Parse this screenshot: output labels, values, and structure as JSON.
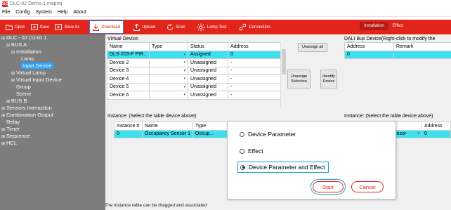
{
  "window": {
    "title": "DLC-02   Demo-1.maproj",
    "logo_text": "DLC"
  },
  "menu": [
    "File",
    "Config",
    "System",
    "Help",
    "About"
  ],
  "toolbar": {
    "open": "Open",
    "save": "Save",
    "save_as": "Save As",
    "download": "Download",
    "upload": "Upload",
    "scan": "Scan",
    "lamp_test": "Lamp Test",
    "connection": "Connection",
    "mode_installation": "Installation",
    "mode_effect": "Effect"
  },
  "tree": [
    {
      "label": "DLC - 02 (1)-ID 1",
      "toggle": "⊟",
      "indent": 0
    },
    {
      "label": "BUS A",
      "toggle": "⊟",
      "indent": 1
    },
    {
      "label": "Installation",
      "toggle": "⊟",
      "indent": 2
    },
    {
      "label": "Lamp",
      "toggle": "",
      "indent": 3
    },
    {
      "label": "Input Device",
      "toggle": "",
      "indent": 3,
      "selected": true
    },
    {
      "label": "Virtual Lamp",
      "toggle": "⊞",
      "indent": 2
    },
    {
      "label": "Virtual Input Device",
      "toggle": "⊞",
      "indent": 2
    },
    {
      "label": "Group",
      "toggle": "",
      "indent": 2
    },
    {
      "label": "Scene",
      "toggle": "",
      "indent": 2
    },
    {
      "label": "BUS B",
      "toggle": "⊞",
      "indent": 1
    },
    {
      "label": "Sensors Interaction",
      "toggle": "⊞",
      "indent": 0
    },
    {
      "label": "Combination Output",
      "toggle": "⊞",
      "indent": 0
    },
    {
      "label": "Relay",
      "toggle": "",
      "indent": 0
    },
    {
      "label": "Timer",
      "toggle": "⊞",
      "indent": 0
    },
    {
      "label": "Sequence",
      "toggle": "⊞",
      "indent": 0
    },
    {
      "label": "HCL",
      "toggle": "⊞",
      "indent": 0
    }
  ],
  "virtual_device": {
    "title": "Virtual Device:",
    "headers": [
      "Name",
      "Type",
      "Status",
      "Address"
    ],
    "rows": [
      {
        "name": "DLS-203-P PIR..",
        "type": "",
        "status": "Assigned",
        "address": "0",
        "highlight": true
      },
      {
        "name": "Device 2",
        "type": "",
        "status": "Unassigned",
        "address": "-"
      },
      {
        "name": "Device 3",
        "type": "",
        "status": "Unassigned",
        "address": "-"
      },
      {
        "name": "Device 4",
        "type": "",
        "status": "Unassigned",
        "address": "-"
      },
      {
        "name": "Device 5",
        "type": "",
        "status": "Unassigned",
        "address": "-"
      },
      {
        "name": "Device 6",
        "type": "",
        "status": "Unassigned",
        "address": "-"
      }
    ]
  },
  "buttons": {
    "unassign_all": "Unassign all",
    "unassign_selection": "Unassign Selection",
    "identify_device": "Identify Device"
  },
  "dali_bus": {
    "title": "DALI Bus Device(Right-click to modify the address)",
    "headers": [
      "Address",
      "Remark"
    ],
    "rows": [
      {
        "address": "0",
        "remark": "",
        "highlight": true
      }
    ]
  },
  "instance_left": {
    "title": "Instance:  (Select the table device above)",
    "headers": [
      "Instance #",
      "Name",
      "Type"
    ],
    "rows": [
      {
        "instance": "0",
        "name": "Occupancy Sensor 1",
        "type": "Occup...",
        "highlight": true
      }
    ]
  },
  "instance_right": {
    "title": "Instance:  (Select the table device above)",
    "headers": [
      "",
      "Address"
    ],
    "rows": [
      {
        "col1": "Sensor",
        "address": "0",
        "highlight": true
      }
    ]
  },
  "dialog": {
    "option1": "Device Parameter",
    "option2": "Effect",
    "option3": "Device Parameter and Effect",
    "selected_option": "Device Parameter and Effect",
    "start": "Start",
    "cancel": "Cancel"
  },
  "footer_note": "The instance table can be dragged and associated",
  "colors": {
    "accent": "#e1251b",
    "highlight": "#3ce0ef",
    "sidebar": "#7d7d7d",
    "selection": "#2aa2ff"
  }
}
